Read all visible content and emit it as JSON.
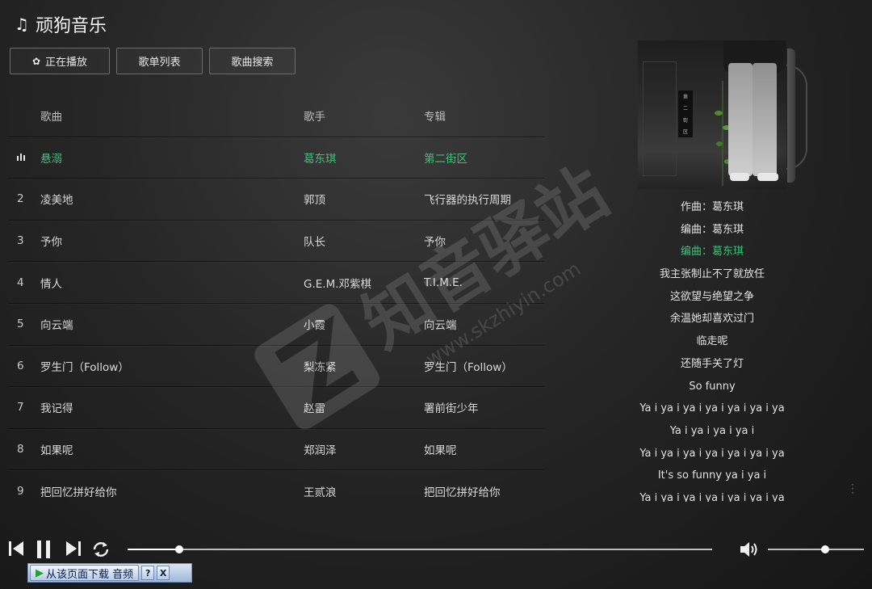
{
  "app": {
    "title": "顽狗音乐",
    "title_icon": "music-note-icon"
  },
  "tabs": [
    {
      "label": "正在播放",
      "icon": "gear-icon"
    },
    {
      "label": "歌单列表"
    },
    {
      "label": "歌曲搜索"
    }
  ],
  "table": {
    "headers": {
      "song": "歌曲",
      "artist": "歌手",
      "album": "专辑"
    },
    "rows": [
      {
        "index": "",
        "song": "悬溺",
        "artist": "葛东琪",
        "album": "第二街区",
        "playing": true
      },
      {
        "index": "2",
        "song": "凌美地",
        "artist": "郭顶",
        "album": "飞行器的执行周期"
      },
      {
        "index": "3",
        "song": "予你",
        "artist": "队长",
        "album": "予你"
      },
      {
        "index": "4",
        "song": "情人",
        "artist": "G.E.M.邓紫棋",
        "album": "T.I.M.E."
      },
      {
        "index": "5",
        "song": "向云端",
        "artist": "小霞",
        "album": "向云端"
      },
      {
        "index": "6",
        "song": "罗生门（Follow）",
        "artist": "梨冻紧",
        "album": "罗生门（Follow）"
      },
      {
        "index": "7",
        "song": "我记得",
        "artist": "赵雷",
        "album": "署前街少年"
      },
      {
        "index": "8",
        "song": "如果呢",
        "artist": "郑润泽",
        "album": "如果呢"
      },
      {
        "index": "9",
        "song": "把回忆拼好给你",
        "artist": "王贰浪",
        "album": "把回忆拼好给你"
      }
    ]
  },
  "album_art": {
    "spine_text": [
      "第",
      "二",
      "街",
      "区"
    ]
  },
  "lyrics": {
    "lines": [
      "作曲：葛东琪",
      "编曲：葛东琪",
      "编曲：葛东琪",
      "我主张制止不了就放任",
      "这欲望与绝望之争",
      "余温她却喜欢过门",
      "临走呢",
      "还随手关了灯",
      "So funny",
      "Ya i ya i ya i ya i ya i ya i ya",
      "Ya i ya i ya i ya i",
      "Ya i ya i ya i ya i ya i ya i ya",
      "It's so funny ya i ya i",
      "Ya i ya i ya i ya i ya i ya i ya"
    ],
    "current_index": 2
  },
  "player": {
    "progress": 0.088,
    "volume": 0.6,
    "icons": [
      "previous-icon",
      "pause-icon",
      "next-icon",
      "loop-icon",
      "volume-icon"
    ]
  },
  "download_bar": {
    "label": "从该页面下载 音频",
    "help": "?",
    "close": "X"
  },
  "watermark": {
    "text": "知音驿站",
    "url": "www.skzhiyin.com"
  },
  "colors": {
    "accent": "#3fc27a",
    "background": "#262626",
    "text": "#d9d9d9"
  }
}
